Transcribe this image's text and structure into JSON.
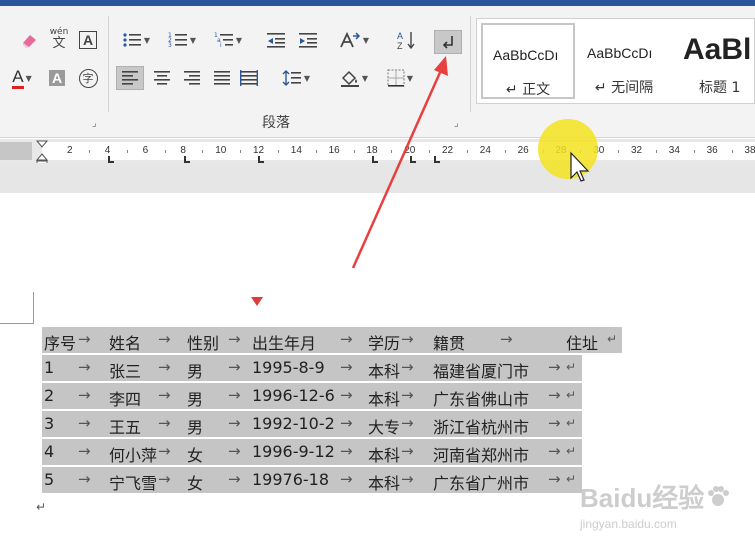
{
  "ribbon": {
    "paragraph_group_label": "段落",
    "phonetic_label": "wén",
    "phonetic_char": "文",
    "enclose_char": "字",
    "char_border": "A",
    "font_color_glyph": "A",
    "char_shading_glyph": "A",
    "clear_format_glyph": "A",
    "styles": [
      {
        "sample": "AaBbCcDı",
        "name": "↵ 正文",
        "active": true
      },
      {
        "sample": "AaBbCcDı",
        "name": "↵ 无间隔",
        "active": false
      },
      {
        "sample": "AaBl",
        "name": "标题 1",
        "active": false
      }
    ]
  },
  "ruler": {
    "ticks": [
      "2",
      "4",
      "6",
      "8",
      "10",
      "12",
      "14",
      "16",
      "18",
      "20",
      "22",
      "24",
      "26",
      "28",
      "30",
      "32",
      "34",
      "36",
      "38"
    ]
  },
  "document": {
    "rows": [
      {
        "cells": [
          "序号",
          "姓名",
          "性别",
          "出生年月",
          "学历",
          "籍贯",
          "住址"
        ],
        "header": true
      },
      {
        "cells": [
          "1",
          "张三",
          "男",
          "1995-8-9",
          "本科",
          "福建省厦门市"
        ]
      },
      {
        "cells": [
          "2",
          "李四",
          "男",
          "1996-12-6",
          "本科",
          "广东省佛山市"
        ]
      },
      {
        "cells": [
          "3",
          "王五",
          "男",
          "1992-10-2",
          "大专",
          "浙江省杭州市"
        ]
      },
      {
        "cells": [
          "4",
          "何小萍",
          "女",
          "1996-9-12",
          "本科",
          "河南省郑州市"
        ]
      },
      {
        "cells": [
          "5",
          "宁飞雪",
          "女",
          "19976-18",
          "本科",
          "广东省广州市"
        ]
      }
    ],
    "tab_glyph": "→",
    "para_glyph": "↵"
  },
  "watermark": {
    "brand": "Baidu经验",
    "url": "jingyan.baidu.com"
  },
  "colors": {
    "accent": "#2b579a",
    "font_red": "#e02020",
    "annotation_red": "#e03b3b",
    "highlight": "#f5e21e"
  }
}
